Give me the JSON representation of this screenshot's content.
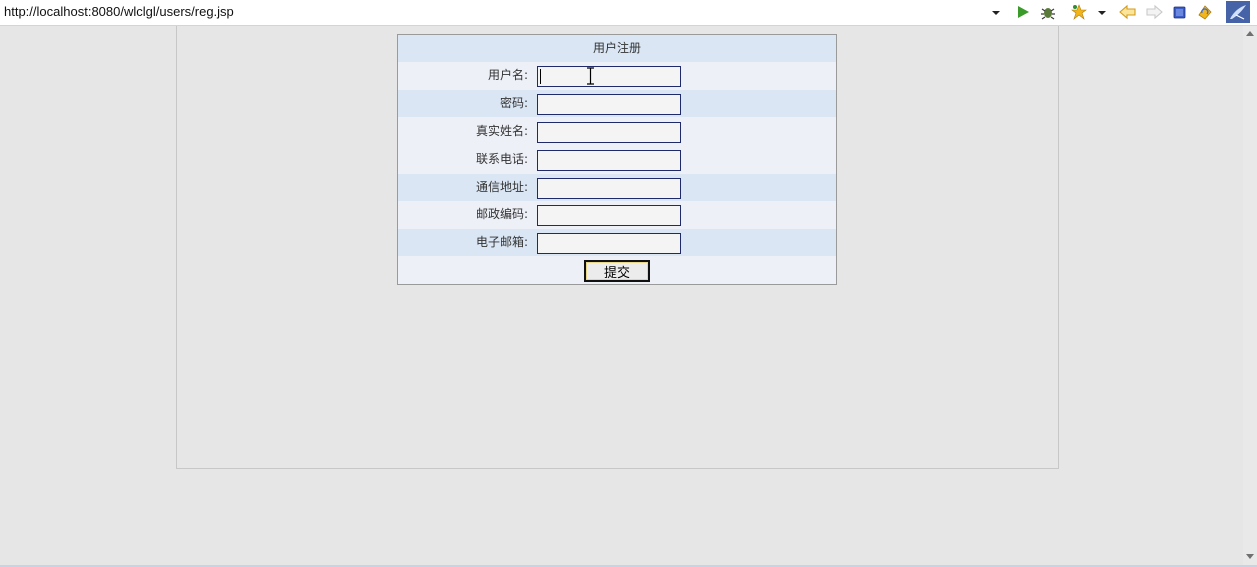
{
  "browser": {
    "url": "http://localhost:8080/wlclgl/users/reg.jsp",
    "toolbar_icons": [
      "dropdown-arrow-icon",
      "run-icon",
      "debug-icon",
      "favorites-icon",
      "favorites-dropdown-icon",
      "back-icon",
      "forward-icon",
      "stop-icon",
      "refresh-icon",
      "ide-logo-icon"
    ]
  },
  "form": {
    "title": "用户注册",
    "fields": [
      {
        "label": "用户名:",
        "value": ""
      },
      {
        "label": "密码:",
        "value": ""
      },
      {
        "label": "真实姓名:",
        "value": ""
      },
      {
        "label": "联系电话:",
        "value": ""
      },
      {
        "label": "通信地址:",
        "value": ""
      },
      {
        "label": "邮政编码:",
        "value": ""
      },
      {
        "label": "电子邮箱:",
        "value": ""
      }
    ],
    "submit_label": "提交"
  },
  "colors": {
    "page_bg": "#e6e6e6",
    "row_alt": "#dae6f4",
    "row_plain": "#eef0f8",
    "input_border": "#1f2a6b"
  }
}
